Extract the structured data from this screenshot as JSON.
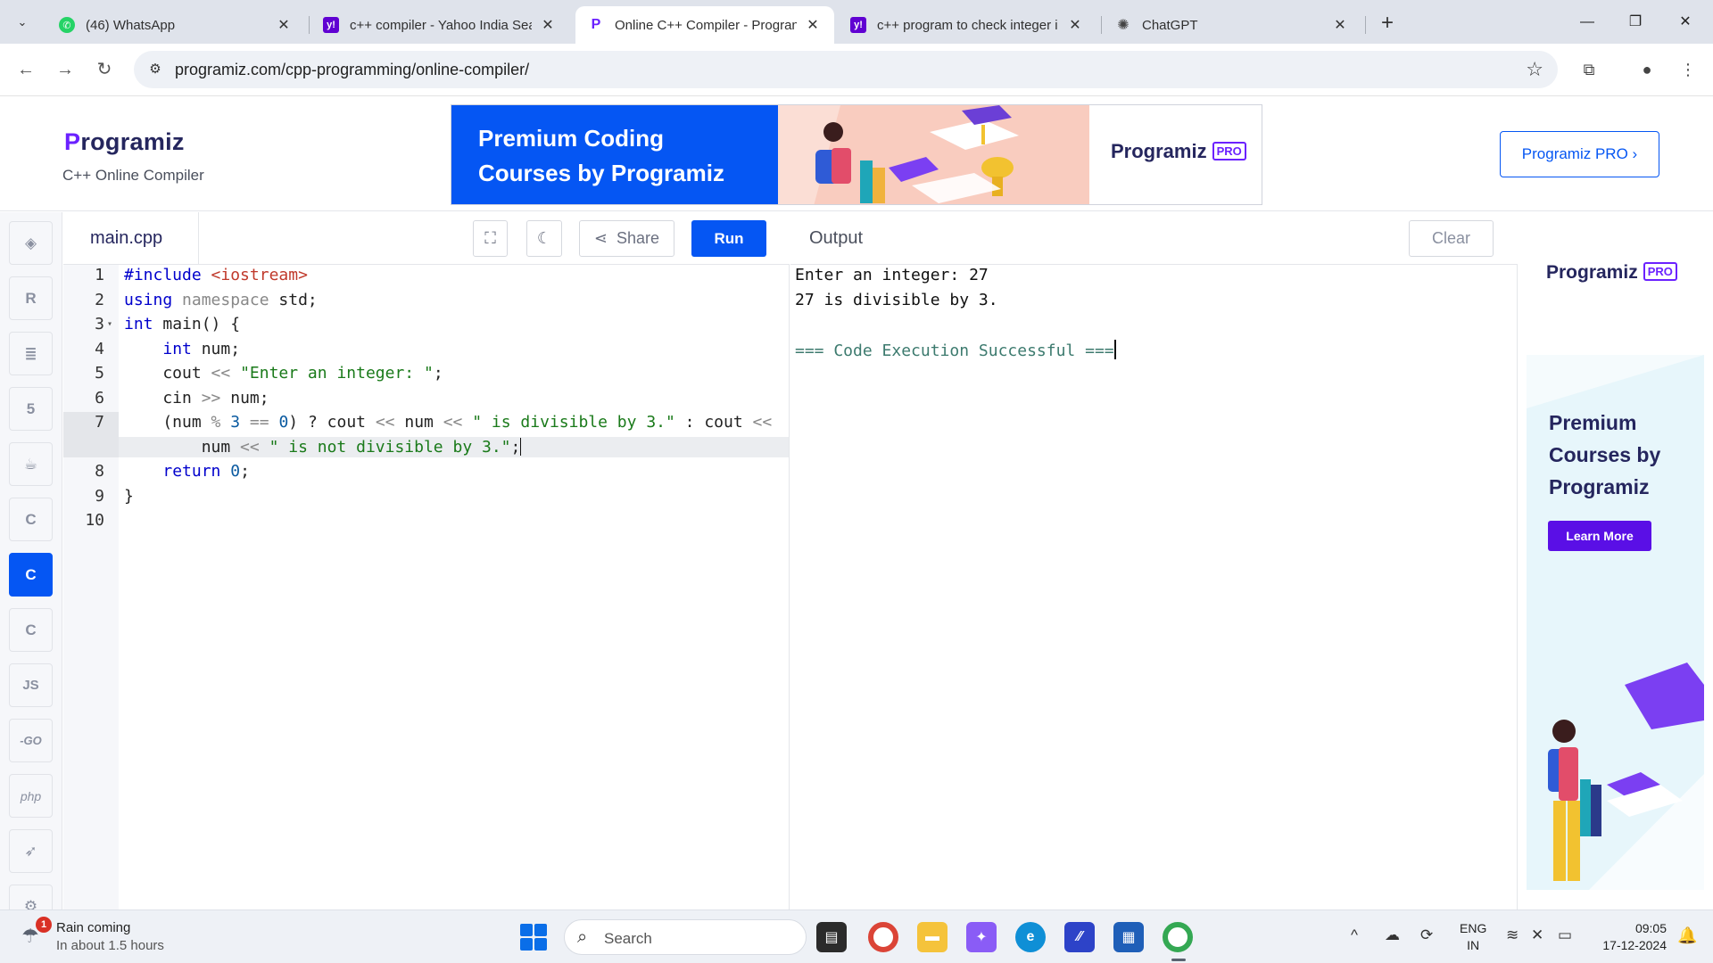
{
  "browser": {
    "tabs": [
      {
        "label": "(46) WhatsApp",
        "favicon": "whatsapp-icon",
        "color": "#25d366"
      },
      {
        "label": "c++ compiler - Yahoo India Sea",
        "favicon": "yahoo-icon",
        "color": "#6001d2"
      },
      {
        "label": "Online C++ Compiler - Progran",
        "favicon": "programiz-icon",
        "color": "#6b21ff",
        "active": true
      },
      {
        "label": "c++ program to check integer i",
        "favicon": "yahoo-icon",
        "color": "#6001d2"
      },
      {
        "label": "ChatGPT",
        "favicon": "chatgpt-icon",
        "color": "#444444"
      }
    ],
    "url": "programiz.com/cpp-programming/online-compiler/"
  },
  "site": {
    "logo_p": "P",
    "logo_rest": "rogramiz",
    "subtitle": "C++ Online Compiler",
    "banner": {
      "headline_line1": "Premium Coding",
      "headline_line2": "Courses by Programiz",
      "brand": "Programiz",
      "brand_badge": "PRO"
    },
    "pro_button": "Programiz PRO ›"
  },
  "languages": [
    {
      "name": "python",
      "glyph": "🐍"
    },
    {
      "name": "r",
      "glyph": "R"
    },
    {
      "name": "sql",
      "glyph": "≣"
    },
    {
      "name": "html",
      "glyph": "5"
    },
    {
      "name": "java",
      "glyph": "☕"
    },
    {
      "name": "c",
      "glyph": "C"
    },
    {
      "name": "cpp",
      "glyph": "C",
      "active": true
    },
    {
      "name": "csharp",
      "glyph": "C"
    },
    {
      "name": "javascript",
      "glyph": "JS"
    },
    {
      "name": "go",
      "glyph": "GO"
    },
    {
      "name": "php",
      "glyph": "php"
    },
    {
      "name": "swift",
      "glyph": "➶"
    },
    {
      "name": "rust",
      "glyph": "R"
    }
  ],
  "editor": {
    "filename": "main.cpp",
    "share_label": "Share",
    "run_label": "Run",
    "line_numbers": [
      "1",
      "2",
      "3",
      "4",
      "5",
      "6",
      "7",
      "",
      "8",
      "9",
      "10"
    ]
  },
  "output": {
    "title": "Output",
    "clear_label": "Clear",
    "lines": [
      "Enter an integer: 27",
      "27 is divisible by 3.",
      "",
      "=== Code Execution Successful ==="
    ]
  },
  "side_ad": {
    "brand": "Programiz",
    "brand_badge": "PRO",
    "headline": "Premium Courses by Programiz",
    "button": "Learn More"
  },
  "taskbar": {
    "weather_badge": "1",
    "weather_title": "Rain coming",
    "weather_sub": "In about 1.5 hours",
    "search_label": "Search",
    "lang_line1": "ENG",
    "lang_line2": "IN",
    "time": "09:05",
    "date": "17-12-2024"
  }
}
